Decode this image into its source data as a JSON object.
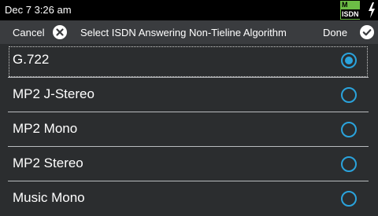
{
  "status": {
    "time": "Dec 7 3:26 am",
    "badge_top": "M",
    "badge_bottom": "ISDN",
    "bolt_icon": "lightning-bolt-icon"
  },
  "header": {
    "cancel_label": "Cancel",
    "title": "Select ISDN Answering Non-Tieline Algorithm",
    "done_label": "Done"
  },
  "options": [
    {
      "label": "G.722",
      "selected": true
    },
    {
      "label": "MP2 J-Stereo",
      "selected": false
    },
    {
      "label": "MP2 Mono",
      "selected": false
    },
    {
      "label": "MP2 Stereo",
      "selected": false
    },
    {
      "label": "Music Mono",
      "selected": false
    }
  ],
  "colors": {
    "accent": "#2aa3dc",
    "background": "#2b2d2f",
    "header": "#3a3c3f",
    "badge": "#6cbd45"
  }
}
